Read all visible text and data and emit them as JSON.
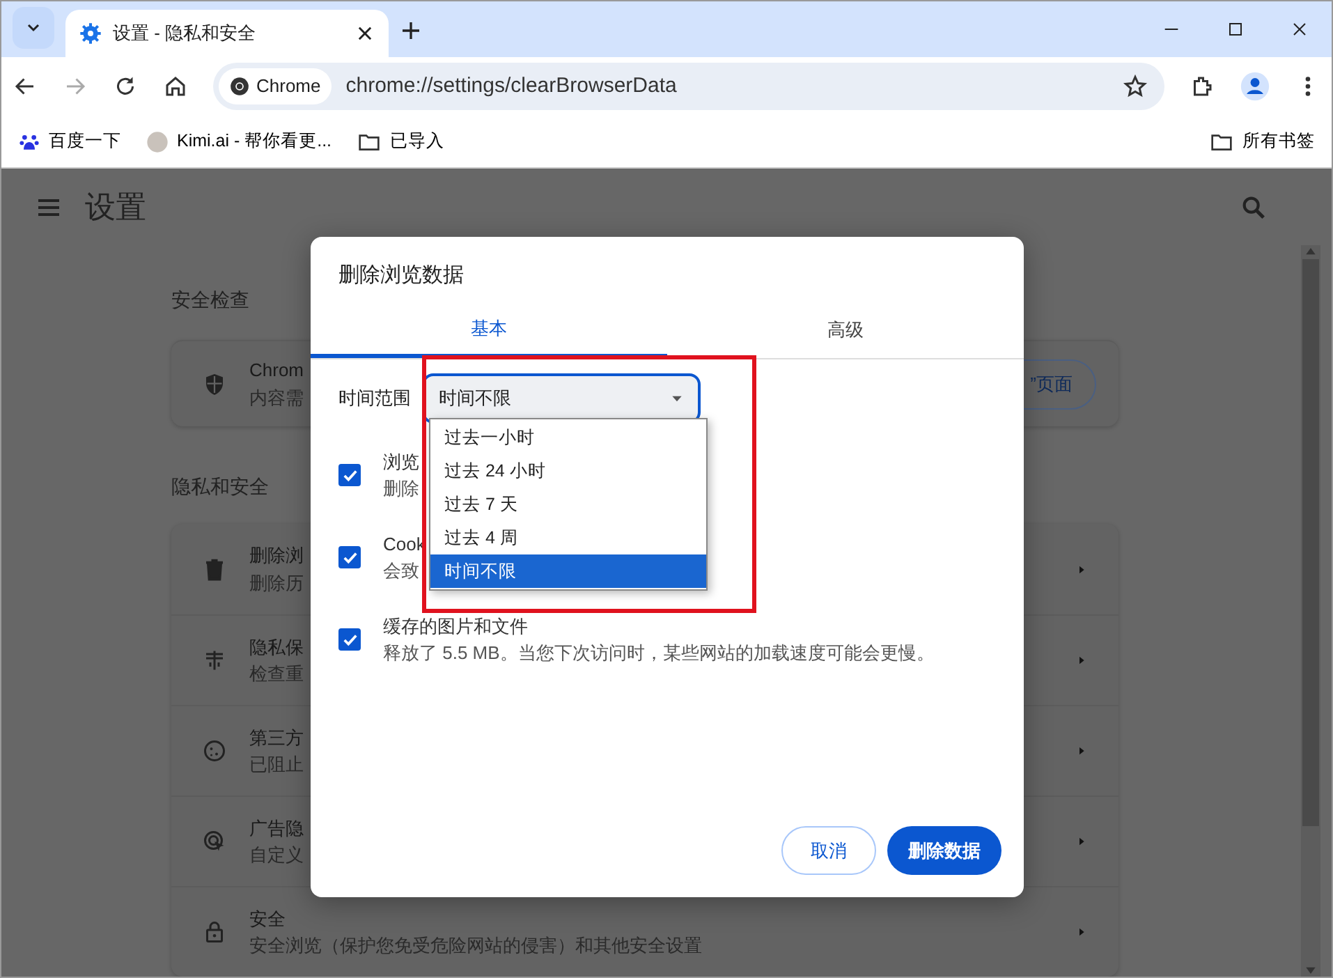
{
  "window": {
    "tab_title": "设置 - 隐私和安全"
  },
  "toolbar": {
    "chip": "Chrome",
    "url": "chrome://settings/clearBrowserData"
  },
  "bookmarks": [
    {
      "kind": "paw",
      "label": "百度一下"
    },
    {
      "kind": "avatar",
      "label": "Kimi.ai - 帮你看更..."
    },
    {
      "kind": "folder",
      "label": "已导入"
    }
  ],
  "all_bookmarks": "所有书签",
  "settings": {
    "title": "设置",
    "safety_check": {
      "heading": "安全检查",
      "line_1": "Chrom",
      "line_2": "内容需",
      "button": "”页面"
    },
    "privacy": {
      "heading": "隐私和安全",
      "items": [
        {
          "kind": "trash",
          "title": "删除浏",
          "subtitle": "删除历"
        },
        {
          "kind": "tune",
          "title": "隐私保",
          "subtitle": "检查重"
        },
        {
          "kind": "cookie",
          "title": "第三方",
          "subtitle": "已阻止"
        },
        {
          "kind": "ad",
          "title": "广告隐",
          "subtitle": "自定义"
        },
        {
          "kind": "lock",
          "title": "安全",
          "subtitle": "安全浏览（保护您免受危险网站的侵害）和其他安全设置"
        }
      ]
    }
  },
  "dialog": {
    "title": "删除浏览数据",
    "tabs": [
      {
        "label": "基本",
        "selected": true
      },
      {
        "label": "高级",
        "selected": false
      }
    ],
    "time_range": {
      "label": "时间范围",
      "value": "时间不限",
      "expanded": true,
      "options": [
        {
          "label": "过去一小时",
          "selected": false
        },
        {
          "label": "过去 24 小时",
          "selected": false
        },
        {
          "label": "过去 7 天",
          "selected": false
        },
        {
          "label": "过去 4 周",
          "selected": false
        },
        {
          "label": "时间不限",
          "selected": true
        }
      ]
    },
    "items": [
      {
        "title": "浏览",
        "subtitle": "删除",
        "checked": true
      },
      {
        "title": "Cook",
        "subtitle": "会致",
        "checked": true
      },
      {
        "title": "缓存的图片和文件",
        "subtitle": "释放了 5.5 MB。当您下次访问时，某些网站的加载速度可能会更慢。",
        "checked": true
      }
    ],
    "cancel": "取消",
    "confirm": "删除数据"
  }
}
